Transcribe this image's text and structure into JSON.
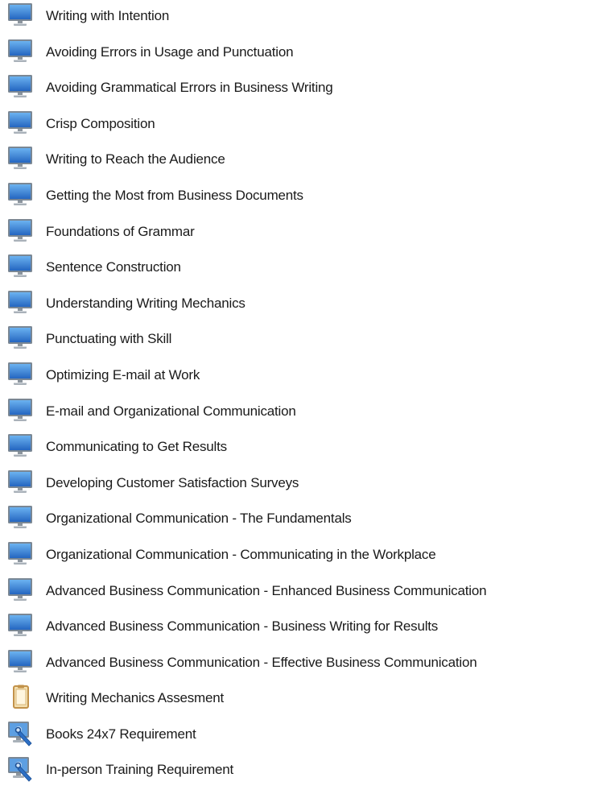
{
  "course_list": {
    "items": [
      {
        "label": "Writing with Intention",
        "icon": "computer-monitor-icon"
      },
      {
        "label": "Avoiding Errors in Usage and Punctuation",
        "icon": "computer-monitor-icon"
      },
      {
        "label": "Avoiding Grammatical Errors in Business Writing",
        "icon": "computer-monitor-icon"
      },
      {
        "label": "Crisp Composition",
        "icon": "computer-monitor-icon"
      },
      {
        "label": "Writing to Reach the Audience",
        "icon": "computer-monitor-icon"
      },
      {
        "label": "Getting the Most from Business Documents",
        "icon": "computer-monitor-icon"
      },
      {
        "label": "Foundations of Grammar",
        "icon": "computer-monitor-icon"
      },
      {
        "label": "Sentence Construction",
        "icon": "computer-monitor-icon"
      },
      {
        "label": "Understanding Writing Mechanics",
        "icon": "computer-monitor-icon"
      },
      {
        "label": "Punctuating with Skill",
        "icon": "computer-monitor-icon"
      },
      {
        "label": "Optimizing E-mail at Work",
        "icon": "computer-monitor-icon"
      },
      {
        "label": "E-mail and Organizational Communication",
        "icon": "computer-monitor-icon"
      },
      {
        "label": "Communicating to Get Results",
        "icon": "computer-monitor-icon"
      },
      {
        "label": "Developing Customer Satisfaction Surveys",
        "icon": "computer-monitor-icon"
      },
      {
        "label": "Organizational Communication - The Fundamentals",
        "icon": "computer-monitor-icon"
      },
      {
        "label": "Organizational Communication - Communicating in the Workplace",
        "icon": "computer-monitor-icon"
      },
      {
        "label": "Advanced Business Communication - Enhanced Business Communication",
        "icon": "computer-monitor-icon"
      },
      {
        "label": "Advanced Business Communication - Business Writing for Results",
        "icon": "computer-monitor-icon"
      },
      {
        "label": "Advanced Business Communication - Effective Business Communication",
        "icon": "computer-monitor-icon"
      },
      {
        "label": "Writing Mechanics Assesment",
        "icon": "document-icon"
      },
      {
        "label": "Books 24x7 Requirement",
        "icon": "monitor-wrench-icon"
      },
      {
        "label": "In-person Training Requirement",
        "icon": "monitor-wrench-icon"
      }
    ]
  },
  "colors": {
    "monitor_screen": "#3a86d8",
    "monitor_frame": "#7a8794",
    "document_body": "#f3dfb0",
    "document_border": "#c2924a",
    "wrench": "#2d6fc4",
    "text": "#1a1a1a"
  }
}
